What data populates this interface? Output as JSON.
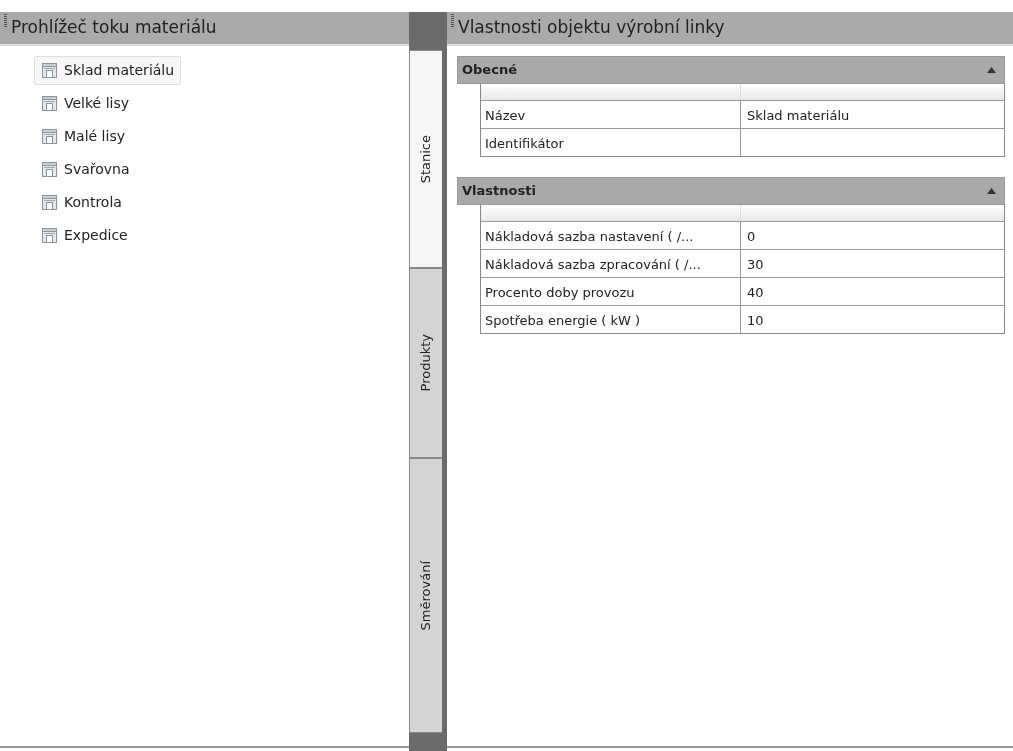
{
  "left_panel": {
    "title": "Prohlížeč toku materiálu",
    "tree": [
      {
        "label": "Sklad materiálu",
        "selected": true
      },
      {
        "label": "Velké lisy",
        "selected": false
      },
      {
        "label": "Malé lisy",
        "selected": false
      },
      {
        "label": "Svařovna",
        "selected": false
      },
      {
        "label": "Kontrola",
        "selected": false
      },
      {
        "label": "Expedice",
        "selected": false
      }
    ]
  },
  "side_tabs": [
    {
      "label": "Stanice",
      "selected": true
    },
    {
      "label": "Produkty",
      "selected": false
    },
    {
      "label": "Směrování",
      "selected": false
    }
  ],
  "right_panel": {
    "title": "Vlastnosti objektu výrobní linky",
    "sections": [
      {
        "title": "Obecné",
        "expanded": true,
        "rows": [
          {
            "name": "Název",
            "value": "Sklad materiálu"
          },
          {
            "name": "Identifikátor"
          }
        ]
      },
      {
        "title": "Vlastnosti",
        "expanded": true,
        "rows": [
          {
            "name": "Nákladová sazba nastavení ( /...",
            "value": "0"
          },
          {
            "name": "Nákladová sazba zpracování ( /...",
            "value": "30"
          },
          {
            "name": "Procento doby provozu",
            "value": "40"
          },
          {
            "name": "Spotřeba energie ( kW )",
            "value": "10"
          }
        ]
      }
    ]
  }
}
